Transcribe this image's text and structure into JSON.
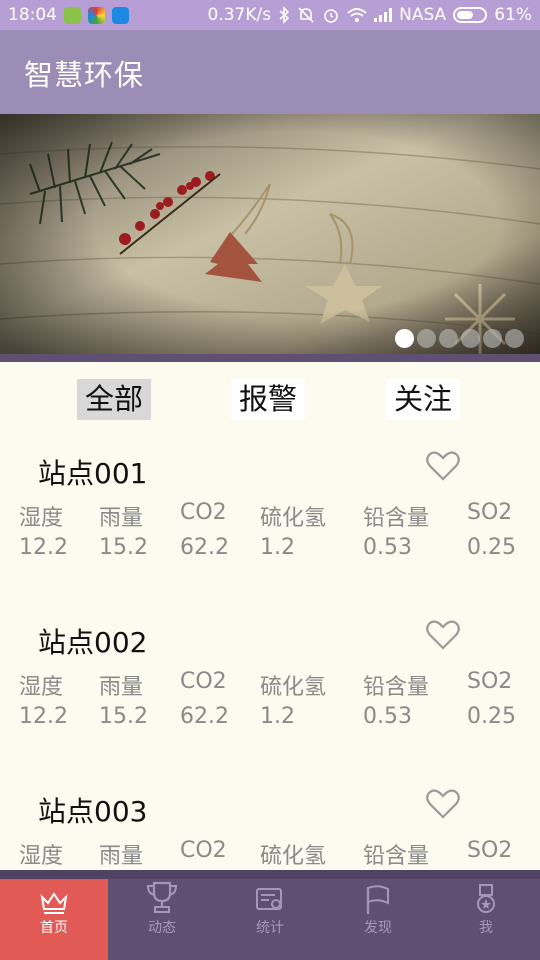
{
  "status_bar": {
    "time": "18:04",
    "speed": "0.37K/s",
    "carrier": "NASA",
    "battery": "61%",
    "battery_level": 0.61,
    "icons": [
      "shield-app-icon",
      "colorful-app-icon",
      "blue-app-icon",
      "bluetooth-icon",
      "mute-icon",
      "alarm-icon",
      "wifi-icon",
      "signal-icon",
      "battery-icon"
    ]
  },
  "header": {
    "title": "智慧环保"
  },
  "banner": {
    "slide_count": 6,
    "active_index": 0
  },
  "tabs": [
    {
      "label": "全部",
      "active": true
    },
    {
      "label": "报警",
      "active": false
    },
    {
      "label": "关注",
      "active": false
    }
  ],
  "stations": [
    {
      "name": "站点001",
      "metrics": [
        {
          "label": "湿度",
          "value": "12.2"
        },
        {
          "label": "雨量",
          "value": "15.2"
        },
        {
          "label": "CO2",
          "value": "62.2"
        },
        {
          "label": "硫化氢",
          "value": "1.2"
        },
        {
          "label": "铅含量",
          "value": "0.53"
        },
        {
          "label": "SO2",
          "value": "0.25"
        }
      ]
    },
    {
      "name": "站点002",
      "metrics": [
        {
          "label": "湿度",
          "value": "12.2"
        },
        {
          "label": "雨量",
          "value": "15.2"
        },
        {
          "label": "CO2",
          "value": "62.2"
        },
        {
          "label": "硫化氢",
          "value": "1.2"
        },
        {
          "label": "铅含量",
          "value": "0.53"
        },
        {
          "label": "SO2",
          "value": "0.25"
        }
      ]
    },
    {
      "name": "站点003",
      "metrics": [
        {
          "label": "湿度",
          "value": ""
        },
        {
          "label": "雨量",
          "value": ""
        },
        {
          "label": "CO2",
          "value": ""
        },
        {
          "label": "硫化氢",
          "value": ""
        },
        {
          "label": "铅含量",
          "value": ""
        },
        {
          "label": "SO2",
          "value": ""
        }
      ]
    }
  ],
  "tabbar": [
    {
      "label": "首页",
      "icon": "crown-icon",
      "active": true
    },
    {
      "label": "动态",
      "icon": "trophy-icon",
      "active": false
    },
    {
      "label": "统计",
      "icon": "certificate-icon",
      "active": false
    },
    {
      "label": "发现",
      "icon": "flag-icon",
      "active": false
    },
    {
      "label": "我",
      "icon": "medal-icon",
      "active": false
    }
  ],
  "colors": {
    "status_bar": "#b79fd6",
    "header": "#9c8db6",
    "tabbar": "#5f5072",
    "tabbar_active": "#e25a55",
    "content_bg": "#fbfbef"
  }
}
